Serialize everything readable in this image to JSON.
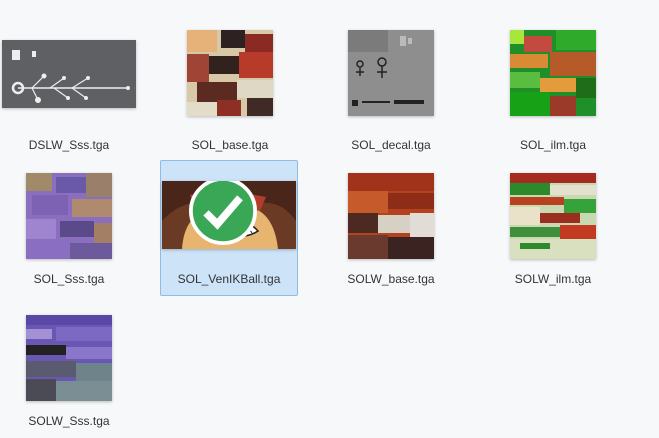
{
  "files": [
    {
      "name": "DSLW_Sss.tga",
      "selected": false,
      "icon": "texture-thumbnail"
    },
    {
      "name": "SOL_base.tga",
      "selected": false,
      "icon": "texture-thumbnail"
    },
    {
      "name": "SOL_decal.tga",
      "selected": false,
      "icon": "texture-thumbnail"
    },
    {
      "name": "SOL_ilm.tga",
      "selected": false,
      "icon": "texture-thumbnail"
    },
    {
      "name": "SOL_Sss.tga",
      "selected": false,
      "icon": "texture-thumbnail"
    },
    {
      "name": "SOL_VenIKBall.tga",
      "selected": true,
      "icon": "texture-thumbnail",
      "badge": "check-icon"
    },
    {
      "name": "SOLW_base.tga",
      "selected": false,
      "icon": "texture-thumbnail"
    },
    {
      "name": "SOLW_ilm.tga",
      "selected": false,
      "icon": "texture-thumbnail"
    },
    {
      "name": "SOLW_Sss.tga",
      "selected": false,
      "icon": "texture-thumbnail"
    }
  ],
  "colors": {
    "selection_bg": "#cde3f8",
    "selection_border": "#8fbce6",
    "check_badge": "#3aa757"
  }
}
